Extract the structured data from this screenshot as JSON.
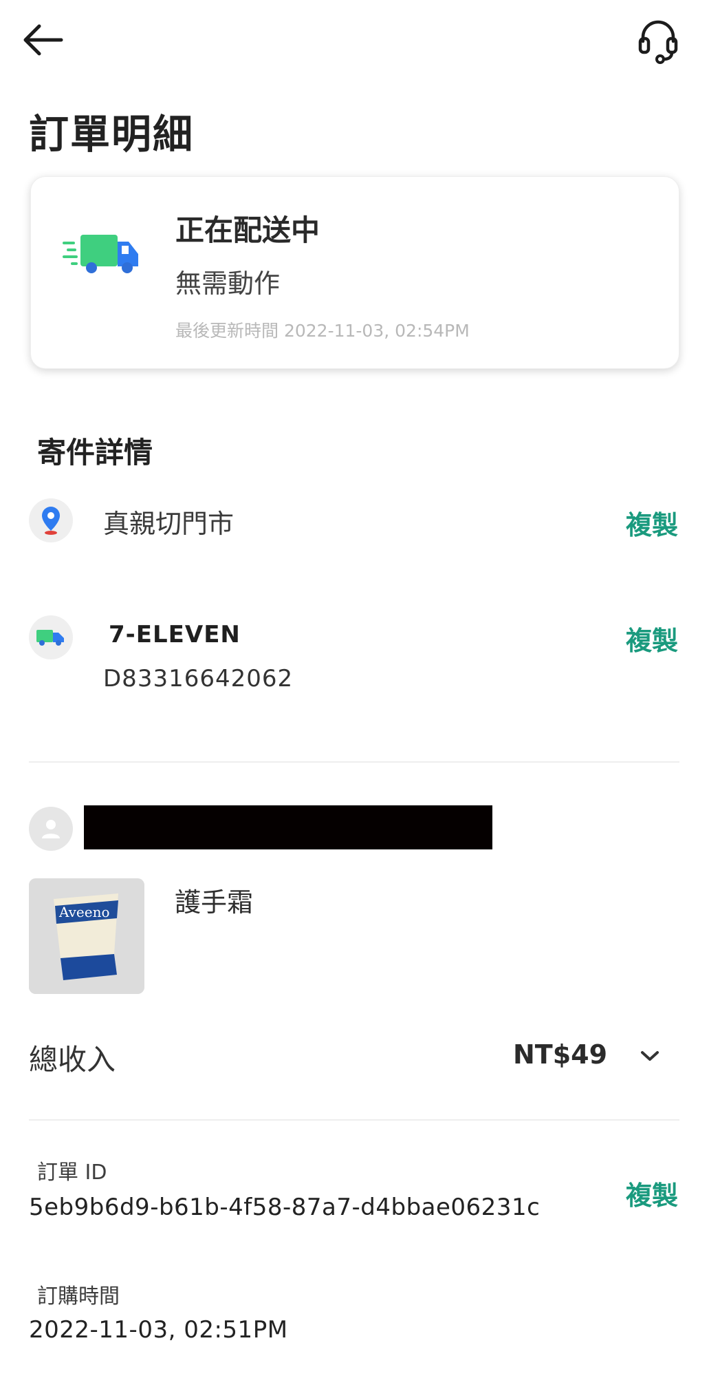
{
  "header": {
    "back_icon": "arrow-left-icon",
    "support_icon": "headset-icon"
  },
  "page": {
    "title": "訂單明細"
  },
  "status": {
    "icon": "delivery-truck-icon",
    "title": "正在配送中",
    "subtitle": "無需動作",
    "last_updated": "最後更新時間 2022-11-03, 02:54PM"
  },
  "shipping": {
    "section_title": "寄件詳情",
    "store": {
      "icon": "location-pin-icon",
      "name": "真親切門市",
      "copy_label": "複製"
    },
    "carrier": {
      "icon": "truck-icon",
      "name": "7-ELEVEN",
      "tracking_number": "D83316642062",
      "copy_label": "複製"
    }
  },
  "buyer": {
    "avatar_icon": "user-avatar-icon"
  },
  "product": {
    "name": "護手霜",
    "image_text": "Aveeno"
  },
  "total": {
    "label": "總收入",
    "amount": "NT$49",
    "expand_icon": "chevron-down-icon"
  },
  "order": {
    "id_label": "訂單 ID",
    "id_value": "5eb9b6d9-b61b-4f58-87a7-d4bbae06231c",
    "copy_label": "複製",
    "time_label": "訂購時間",
    "time_value": "2022-11-03, 02:51PM"
  },
  "colors": {
    "accent": "#1a9a7e",
    "truck_green": "#3fcf7f",
    "truck_blue": "#2f7cf0",
    "pin_blue": "#2f7cf0",
    "pin_red": "#e0413a"
  }
}
